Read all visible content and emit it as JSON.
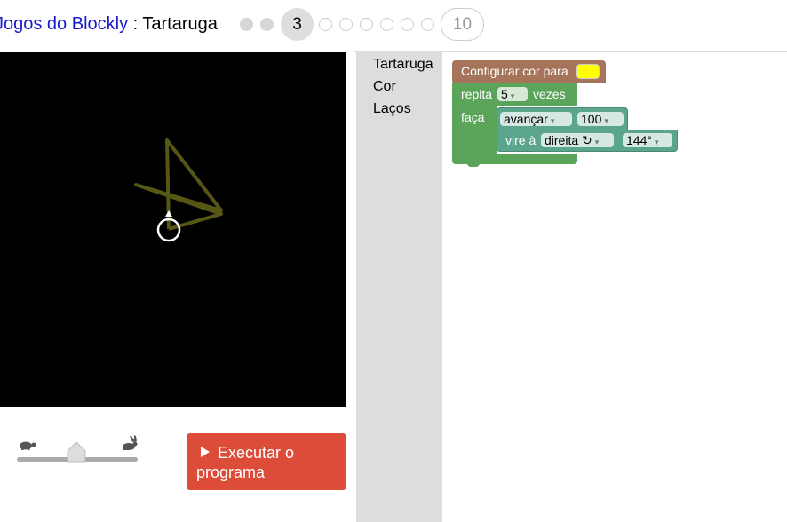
{
  "header": {
    "app_title": "Jogos do Blockly",
    "separator": " : ",
    "game_title": "Tartaruga",
    "current_level": "3",
    "last_level": "10"
  },
  "speed": {
    "slow_icon": "turtle-icon",
    "fast_icon": "rabbit-icon",
    "value": 0.5
  },
  "run_button": {
    "label_line1": "Executar o",
    "label_line2": "programa"
  },
  "toolbox": {
    "items": [
      "Tartaruga",
      "Cor",
      "Laços"
    ]
  },
  "blocks": {
    "set_color": {
      "label": "Configurar cor para",
      "color": "#ffff00"
    },
    "repeat": {
      "label": "repita",
      "count": "5",
      "suffix": "vezes",
      "do_label": "faça"
    },
    "move": {
      "direction": "avançar",
      "amount": "100"
    },
    "turn": {
      "label": "vire à",
      "direction": "direita ↻",
      "angle": "144°"
    }
  },
  "colors": {
    "run_button": "#dd4b39",
    "loop_block": "#5ba55b",
    "turtle_block": "#5ba58c",
    "color_block": "#a5745b",
    "star_stroke": "#565615",
    "header_link": "#1a1acc"
  }
}
